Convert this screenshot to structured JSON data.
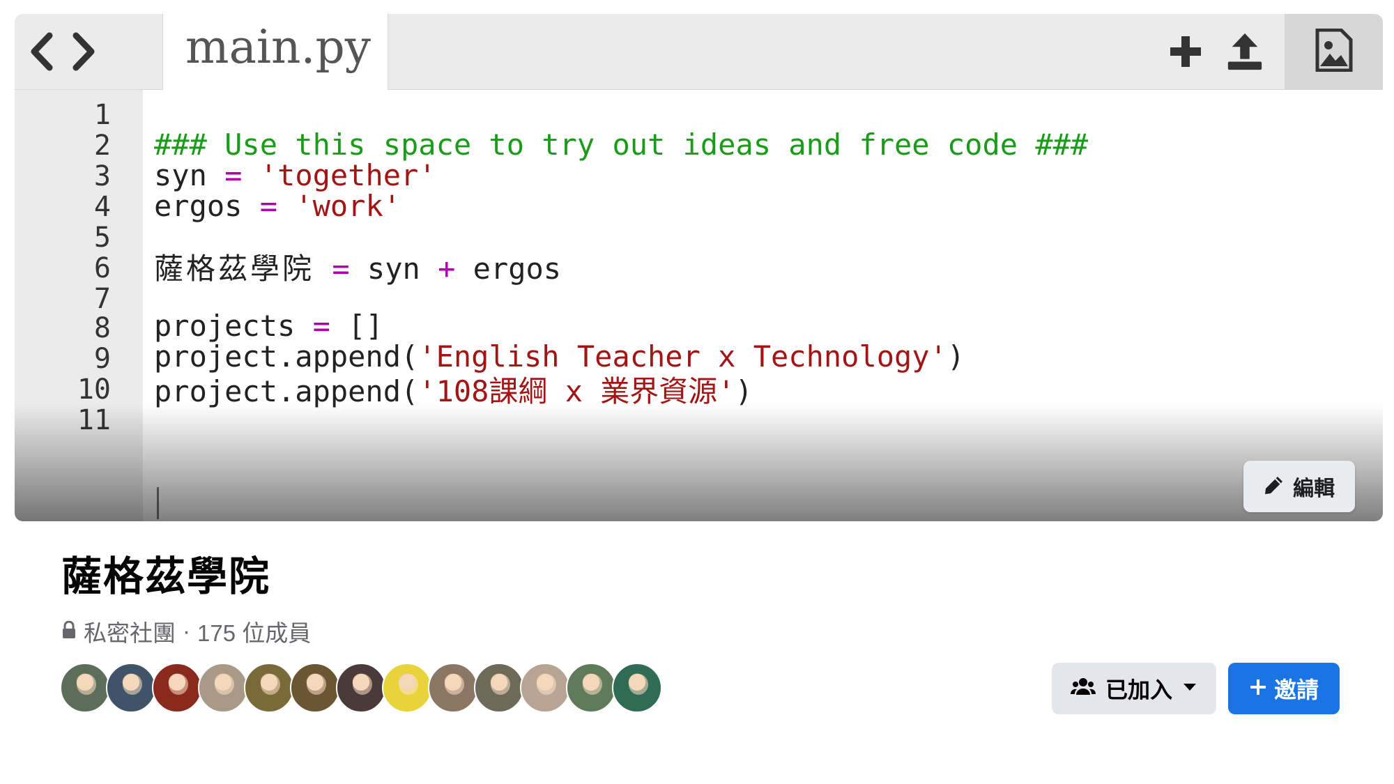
{
  "editor": {
    "tab_name": "main.py",
    "nav_icons": [
      "chevron-left-icon",
      "chevron-right-icon"
    ],
    "header_icons": [
      "plus-icon",
      "upload-icon",
      "image-icon"
    ],
    "line_numbers": [
      "1",
      "2",
      "3",
      "4",
      "5",
      "6",
      "7",
      "8",
      "9",
      "10",
      "11"
    ],
    "lines": {
      "l2": {
        "comment": "### Use this space to try out ideas and free code ###"
      },
      "l3": {
        "name": "syn",
        "op": "=",
        "string": "'together'"
      },
      "l4": {
        "name": "ergos",
        "op": "=",
        "string": "'work'"
      },
      "l6": {
        "name": "薩格茲學院",
        "op": "=",
        "a": "syn",
        "plus": "+",
        "b": "ergos"
      },
      "l8": {
        "name": "projects",
        "op": "=",
        "rest": "[]"
      },
      "l9": {
        "call": "project.append(",
        "string": "'English Teacher x Technology'",
        "close": ")"
      },
      "l10": {
        "call": "project.append(",
        "string": "'108課綱 x 業界資源'",
        "close": ")"
      }
    },
    "colors": {
      "comment": "#1a9c1a",
      "string": "#a31515",
      "operator": "#b000b0"
    }
  },
  "cover": {
    "edit_label": "編輯",
    "edit_icon": "pencil-icon"
  },
  "group": {
    "name": "薩格茲學院",
    "privacy_icon": "lock-icon",
    "privacy": "私密社團",
    "separator": "·",
    "members_text": "175 位成員",
    "member_avatars": [
      {
        "color": "#5c6e5a"
      },
      {
        "color": "#3f5468"
      },
      {
        "color": "#8a2a1e"
      },
      {
        "color": "#a89a86"
      },
      {
        "color": "#7a6a3a"
      },
      {
        "color": "#6b5634"
      },
      {
        "color": "#4a3b3a"
      },
      {
        "color": "#e8d43a"
      },
      {
        "color": "#8b7563"
      },
      {
        "color": "#6d6a5a"
      },
      {
        "color": "#b8a493"
      },
      {
        "color": "#5f7b5a"
      },
      {
        "color": "#2f6b55"
      }
    ]
  },
  "actions": {
    "joined_label": "已加入",
    "joined_icon": "people-icon",
    "joined_caret": "caret-down-icon",
    "invite_label": "邀請",
    "invite_icon": "plus-icon",
    "brand_color": "#1b74e4"
  }
}
